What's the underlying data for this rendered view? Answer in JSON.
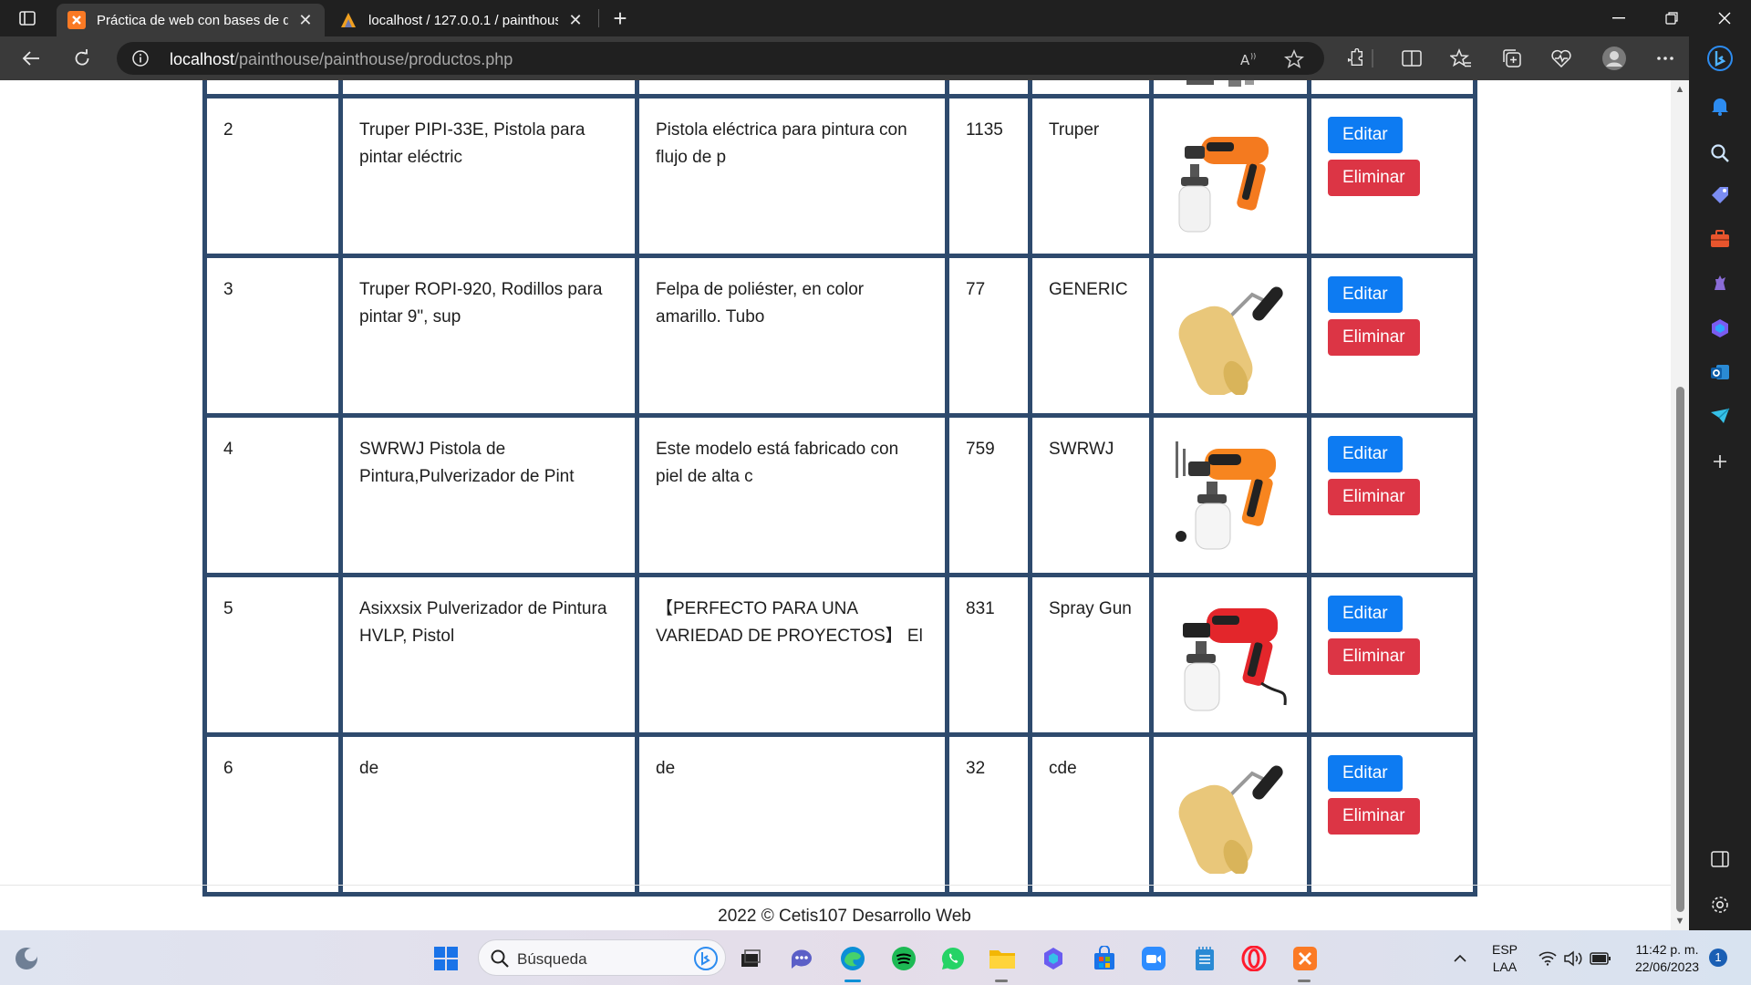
{
  "browser": {
    "tabs": [
      {
        "title": "Práctica de web con bases de da",
        "active": true,
        "favicon": "xampp-icon"
      },
      {
        "title": "localhost / 127.0.0.1 / painthouse",
        "active": false,
        "favicon": "phpmyadmin-icon"
      }
    ],
    "url_host": "localhost",
    "url_path": "/painthouse/painthouse/productos.php"
  },
  "table": {
    "rows": [
      {
        "id": "2",
        "name": "Truper PIPI-33E, Pistola para pintar eléctric",
        "description": "Pistola eléctrica para pintura con flujo de p",
        "price": "1135",
        "brand": "Truper",
        "image": "orange-spray-gun"
      },
      {
        "id": "3",
        "name": "Truper ROPI-920, Rodillos para pintar 9\", sup",
        "description": "Felpa de poliéster, en color amarillo. Tubo",
        "price": "77",
        "brand": "GENERIC",
        "image": "paint-roller"
      },
      {
        "id": "4",
        "name": "SWRWJ Pistola de Pintura,Pulverizador de Pint",
        "description": "Este modelo está fabricado con piel de alta c",
        "price": "759",
        "brand": "SWRWJ",
        "image": "orange-spray-gun"
      },
      {
        "id": "5",
        "name": "Asixxsix Pulverizador de Pintura HVLP, Pistol",
        "description": "【PERFECTO PARA UNA VARIEDAD DE PROYECTOS】 El",
        "price": "831",
        "brand": "Spray Gun",
        "image": "red-spray-gun"
      },
      {
        "id": "6",
        "name": "de",
        "description": "de",
        "price": "32",
        "brand": "cde",
        "image": "paint-roller"
      }
    ],
    "edit_label": "Editar",
    "delete_label": "Eliminar"
  },
  "footer": {
    "text": "2022 © Cetis107 Desarrollo Web"
  },
  "taskbar": {
    "search_placeholder": "Búsqueda",
    "lang_top": "ESP",
    "lang_bottom": "LAA",
    "time": "11:42 p. m.",
    "date": "22/06/2023",
    "notification_count": "1"
  },
  "colors": {
    "table_border": "#2e4a6d",
    "edit_button": "#0d7bf2",
    "delete_button": "#dc3545"
  }
}
